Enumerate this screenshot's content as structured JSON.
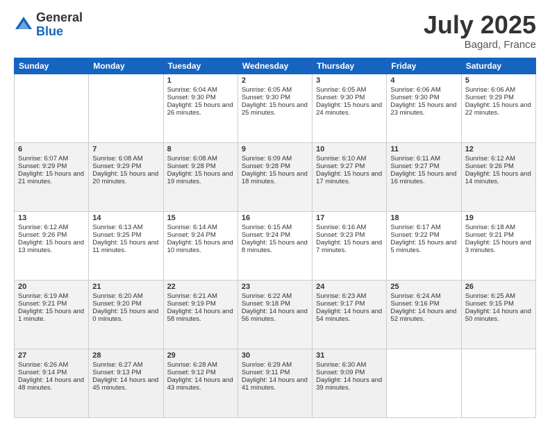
{
  "logo": {
    "general": "General",
    "blue": "Blue"
  },
  "title": "July 2025",
  "location": "Bagard, France",
  "days_of_week": [
    "Sunday",
    "Monday",
    "Tuesday",
    "Wednesday",
    "Thursday",
    "Friday",
    "Saturday"
  ],
  "weeks": [
    [
      {
        "day": "",
        "sunrise": "",
        "sunset": "",
        "daylight": ""
      },
      {
        "day": "",
        "sunrise": "",
        "sunset": "",
        "daylight": ""
      },
      {
        "day": "1",
        "sunrise": "Sunrise: 6:04 AM",
        "sunset": "Sunset: 9:30 PM",
        "daylight": "Daylight: 15 hours and 26 minutes."
      },
      {
        "day": "2",
        "sunrise": "Sunrise: 6:05 AM",
        "sunset": "Sunset: 9:30 PM",
        "daylight": "Daylight: 15 hours and 25 minutes."
      },
      {
        "day": "3",
        "sunrise": "Sunrise: 6:05 AM",
        "sunset": "Sunset: 9:30 PM",
        "daylight": "Daylight: 15 hours and 24 minutes."
      },
      {
        "day": "4",
        "sunrise": "Sunrise: 6:06 AM",
        "sunset": "Sunset: 9:30 PM",
        "daylight": "Daylight: 15 hours and 23 minutes."
      },
      {
        "day": "5",
        "sunrise": "Sunrise: 6:06 AM",
        "sunset": "Sunset: 9:29 PM",
        "daylight": "Daylight: 15 hours and 22 minutes."
      }
    ],
    [
      {
        "day": "6",
        "sunrise": "Sunrise: 6:07 AM",
        "sunset": "Sunset: 9:29 PM",
        "daylight": "Daylight: 15 hours and 21 minutes."
      },
      {
        "day": "7",
        "sunrise": "Sunrise: 6:08 AM",
        "sunset": "Sunset: 9:29 PM",
        "daylight": "Daylight: 15 hours and 20 minutes."
      },
      {
        "day": "8",
        "sunrise": "Sunrise: 6:08 AM",
        "sunset": "Sunset: 9:28 PM",
        "daylight": "Daylight: 15 hours and 19 minutes."
      },
      {
        "day": "9",
        "sunrise": "Sunrise: 6:09 AM",
        "sunset": "Sunset: 9:28 PM",
        "daylight": "Daylight: 15 hours and 18 minutes."
      },
      {
        "day": "10",
        "sunrise": "Sunrise: 6:10 AM",
        "sunset": "Sunset: 9:27 PM",
        "daylight": "Daylight: 15 hours and 17 minutes."
      },
      {
        "day": "11",
        "sunrise": "Sunrise: 6:11 AM",
        "sunset": "Sunset: 9:27 PM",
        "daylight": "Daylight: 15 hours and 16 minutes."
      },
      {
        "day": "12",
        "sunrise": "Sunrise: 6:12 AM",
        "sunset": "Sunset: 9:26 PM",
        "daylight": "Daylight: 15 hours and 14 minutes."
      }
    ],
    [
      {
        "day": "13",
        "sunrise": "Sunrise: 6:12 AM",
        "sunset": "Sunset: 9:26 PM",
        "daylight": "Daylight: 15 hours and 13 minutes."
      },
      {
        "day": "14",
        "sunrise": "Sunrise: 6:13 AM",
        "sunset": "Sunset: 9:25 PM",
        "daylight": "Daylight: 15 hours and 11 minutes."
      },
      {
        "day": "15",
        "sunrise": "Sunrise: 6:14 AM",
        "sunset": "Sunset: 9:24 PM",
        "daylight": "Daylight: 15 hours and 10 minutes."
      },
      {
        "day": "16",
        "sunrise": "Sunrise: 6:15 AM",
        "sunset": "Sunset: 9:24 PM",
        "daylight": "Daylight: 15 hours and 8 minutes."
      },
      {
        "day": "17",
        "sunrise": "Sunrise: 6:16 AM",
        "sunset": "Sunset: 9:23 PM",
        "daylight": "Daylight: 15 hours and 7 minutes."
      },
      {
        "day": "18",
        "sunrise": "Sunrise: 6:17 AM",
        "sunset": "Sunset: 9:22 PM",
        "daylight": "Daylight: 15 hours and 5 minutes."
      },
      {
        "day": "19",
        "sunrise": "Sunrise: 6:18 AM",
        "sunset": "Sunset: 9:21 PM",
        "daylight": "Daylight: 15 hours and 3 minutes."
      }
    ],
    [
      {
        "day": "20",
        "sunrise": "Sunrise: 6:19 AM",
        "sunset": "Sunset: 9:21 PM",
        "daylight": "Daylight: 15 hours and 1 minute."
      },
      {
        "day": "21",
        "sunrise": "Sunrise: 6:20 AM",
        "sunset": "Sunset: 9:20 PM",
        "daylight": "Daylight: 15 hours and 0 minutes."
      },
      {
        "day": "22",
        "sunrise": "Sunrise: 6:21 AM",
        "sunset": "Sunset: 9:19 PM",
        "daylight": "Daylight: 14 hours and 58 minutes."
      },
      {
        "day": "23",
        "sunrise": "Sunrise: 6:22 AM",
        "sunset": "Sunset: 9:18 PM",
        "daylight": "Daylight: 14 hours and 56 minutes."
      },
      {
        "day": "24",
        "sunrise": "Sunrise: 6:23 AM",
        "sunset": "Sunset: 9:17 PM",
        "daylight": "Daylight: 14 hours and 54 minutes."
      },
      {
        "day": "25",
        "sunrise": "Sunrise: 6:24 AM",
        "sunset": "Sunset: 9:16 PM",
        "daylight": "Daylight: 14 hours and 52 minutes."
      },
      {
        "day": "26",
        "sunrise": "Sunrise: 6:25 AM",
        "sunset": "Sunset: 9:15 PM",
        "daylight": "Daylight: 14 hours and 50 minutes."
      }
    ],
    [
      {
        "day": "27",
        "sunrise": "Sunrise: 6:26 AM",
        "sunset": "Sunset: 9:14 PM",
        "daylight": "Daylight: 14 hours and 48 minutes."
      },
      {
        "day": "28",
        "sunrise": "Sunrise: 6:27 AM",
        "sunset": "Sunset: 9:13 PM",
        "daylight": "Daylight: 14 hours and 45 minutes."
      },
      {
        "day": "29",
        "sunrise": "Sunrise: 6:28 AM",
        "sunset": "Sunset: 9:12 PM",
        "daylight": "Daylight: 14 hours and 43 minutes."
      },
      {
        "day": "30",
        "sunrise": "Sunrise: 6:29 AM",
        "sunset": "Sunset: 9:11 PM",
        "daylight": "Daylight: 14 hours and 41 minutes."
      },
      {
        "day": "31",
        "sunrise": "Sunrise: 6:30 AM",
        "sunset": "Sunset: 9:09 PM",
        "daylight": "Daylight: 14 hours and 39 minutes."
      },
      {
        "day": "",
        "sunrise": "",
        "sunset": "",
        "daylight": ""
      },
      {
        "day": "",
        "sunrise": "",
        "sunset": "",
        "daylight": ""
      }
    ]
  ]
}
